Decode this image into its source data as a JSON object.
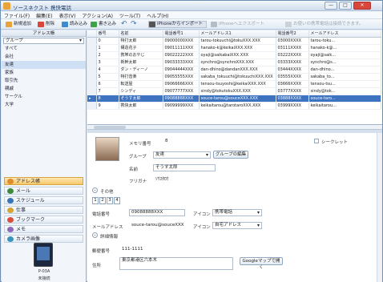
{
  "window": {
    "title": "ソースネクスト 携快電話",
    "min": "—",
    "max": "□",
    "close": "✕"
  },
  "menu": [
    "ファイル(F)",
    "編集(E)",
    "表示(V)",
    "アクション(A)",
    "ツール(T)",
    "ヘルプ(H)"
  ],
  "toolbar": {
    "new": "新規追加",
    "delete": "削除",
    "read": "読み込み",
    "write": "書き込み",
    "iphone_import": "iPhoneからインポート",
    "iphone_export": "iPhoneへエクスポート",
    "notice": "お使いの携帯電話は接続できます。"
  },
  "sidebar": {
    "header": "アドレス帳",
    "combo": "グループ",
    "groups": [
      "すべて",
      "会社",
      "友達",
      "家族",
      "取引先",
      "親戚",
      "サークル",
      "大学"
    ],
    "selected_group": 2,
    "nav": [
      {
        "label": "アドレス帳",
        "color": "#e08b2c"
      },
      {
        "label": "メール",
        "color": "#3d8a3d"
      },
      {
        "label": "スケジュール",
        "color": "#3a73b8"
      },
      {
        "label": "仕事",
        "color": "#d6a531"
      },
      {
        "label": "ブックマーク",
        "color": "#d94f3b"
      },
      {
        "label": "メモ",
        "color": "#8c68b8"
      },
      {
        "label": "カメラ画像",
        "color": "#3a94b8"
      }
    ],
    "selected_nav": 0,
    "device_model": "P-03A",
    "device_status": "未接続"
  },
  "grid": {
    "columns": [
      "",
      "番号",
      "名前",
      "電話番号1",
      "メールアドレス1",
      "電話番号2",
      "メールアドレス"
    ],
    "rows": [
      [
        "0",
        "特打太郎",
        "09000000XXX",
        "tarou-tokuuchi@tokuXXX.XXX",
        "03000XXXX",
        "tarou-toku..."
      ],
      [
        "1",
        "構造花子",
        "09011111XXX",
        "hanako-k@keikaiXXX.XXX",
        "03111XXXX",
        "hanako-k@..."
      ],
      [
        "2",
        "携帯のおやじ",
        "09022222XXX",
        "oyaji@saikabaiXXX.XXX",
        "03222XXXX",
        "oyaji@saik..."
      ],
      [
        "3",
        "新幹太郎",
        "09033333XXX",
        "synchro@synchroXXX.XXX",
        "03333XXXX",
        "synchro@s..."
      ],
      [
        "4",
        "ダン・ディーノ",
        "09044444XXX",
        "dan-dhino@dandanXXX.XXX",
        "03444XXXX",
        "dan-dhino..."
      ],
      [
        "5",
        "特打音楽",
        "09055555XXX",
        "sakaba_tokuuchi@tokuuchiXXX.XXX",
        "03555XXXX",
        "sakaba_to..."
      ],
      [
        "6",
        "転送屋",
        "09066666XXX",
        "tensou-tsuyoshi@keikaiXXX.XXX",
        "03666XXXX",
        "tensou-tsu..."
      ],
      [
        "7",
        "シンディ",
        "09077777XXX",
        "sindy@tokutokuXXX.XXX",
        "03777XXXX",
        "sindy@tok..."
      ],
      [
        "8",
        "そうす太郎",
        "09088888XXX",
        "souce-tarou@souceXXX.XXX",
        "03888XXXX",
        "souce-taro..."
      ],
      [
        "9",
        "携快太郎",
        "09099999XXX",
        "keikaitarou@tarotaroXXX.XXX",
        "03999XXXX",
        "keikaitarou..."
      ]
    ],
    "selected_row": 8,
    "row_marker": "▸"
  },
  "detail": {
    "memory_label": "メモリ番号",
    "memory_value": "8",
    "secret_label": "シークレット",
    "group_label": "グループ",
    "group_value": "友達",
    "group_edit": "グループの編集",
    "name_label": "名前",
    "name_value": "そうす太郎",
    "furigana_label": "フリガナ",
    "furigana_value": "ｿｳｽﾀﾛｳ",
    "other_label": "その他",
    "tabs": [
      "1",
      "2",
      "3",
      "4"
    ],
    "phone_label": "電話番号",
    "phone_value": "09088888XXX",
    "icon_label": "アイコン",
    "phone_icon_value": "携帯電話",
    "email_label": "メールアドレス",
    "email_value": "souce-tarou@souceXXX",
    "email_icon_value": "自宅アドレス",
    "detail_info_label": "詳細情報",
    "postal_label": "郵便番号",
    "postal_value": "111-1111",
    "address_label": "住所",
    "address_value": "東京都港区六本木",
    "map_button": "Googleマップで開く",
    "expand": "⌄"
  }
}
